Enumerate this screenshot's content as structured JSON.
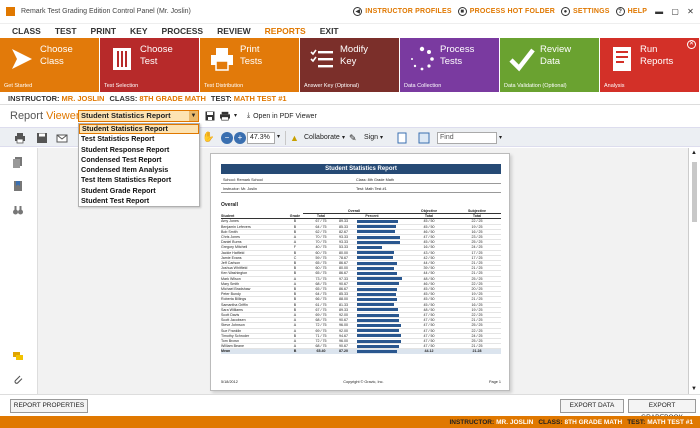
{
  "window": {
    "title": "Remark Test Grading Edition Control Panel (Mr. Joslin)"
  },
  "top_links": {
    "instructor_profiles": "INSTRUCTOR PROFILES",
    "process_hot_folder": "PROCESS HOT FOLDER",
    "settings": "SETTINGS",
    "help": "HELP"
  },
  "menu": [
    "CLASS",
    "TEST",
    "PRINT",
    "KEY",
    "PROCESS",
    "REVIEW",
    "REPORTS",
    "EXIT"
  ],
  "active_menu": "REPORTS",
  "ribbon": {
    "tiles": [
      {
        "label": "Choose\nClass",
        "sub": "Get Started",
        "color": "#e27a0a",
        "icon": "arrow-icon"
      },
      {
        "label": "Choose\nTest",
        "sub": "Test Selection",
        "color": "#b72a2a",
        "icon": "book-icon"
      },
      {
        "label": "Print\nTests",
        "sub": "Test Distribution",
        "color": "#e27a0a",
        "icon": "printer-icon"
      },
      {
        "label": "Modify\nKey",
        "sub": "Answer Key (Optional)",
        "color": "#7b2f2a",
        "icon": "list-icon"
      },
      {
        "label": "Process\nTests",
        "sub": "Data Collection",
        "color": "#7a3aa0",
        "icon": "spinner-icon"
      },
      {
        "label": "Review\nData",
        "sub": "Data Validation (Optional)",
        "color": "#6aa230",
        "icon": "check-icon"
      },
      {
        "label": "Run\nReports",
        "sub": "Analysis",
        "color": "#d33028",
        "icon": "report-icon"
      }
    ]
  },
  "breadcrumb": {
    "instructor_key": "INSTRUCTOR:",
    "instructor": "MR. JOSLIN",
    "class_key": "CLASS:",
    "class": "8TH GRADE MATH",
    "test_key": "TEST:",
    "test": "MATH TEST #1"
  },
  "viewer": {
    "title_a": "Report ",
    "title_b": "Viewer",
    "selected_report": "Student Statistics Report",
    "open_pdf": "Open in PDF Viewer"
  },
  "report_options": [
    "Student Statistics Report",
    "Test Statistics Report",
    "Student Response Report",
    "Condensed Test Report",
    "Condensed Item Analysis",
    "Test Item Statistics Report",
    "Student Grade Report",
    "Student Test Report"
  ],
  "toolbar": {
    "zoom": "47.3%",
    "collaborate": "Collaborate",
    "sign": "Sign",
    "find_placeholder": "Find"
  },
  "report": {
    "title": "Student Statistics Report",
    "school_label": "School:",
    "school": "Remark School",
    "class_label": "Class:",
    "class": "8th Grade Math",
    "instructor_label": "Instructor:",
    "instructor": "Mr. Joslin",
    "test_label": "Test:",
    "test": "Math Test #1",
    "section": "Overall",
    "group_headers": {
      "overall": "Overall",
      "objective": "Objective",
      "subjective": "Subjective"
    },
    "columns": {
      "student": "Student",
      "grade": "Grade",
      "total": "Total",
      "percent": "Percent",
      "obj_total": "Total",
      "subj_total": "Total"
    },
    "rows": [
      {
        "student": "Amy Jones",
        "grade": "B",
        "total": "67 / 75",
        "percent": 89.33,
        "obj": "45 / 50",
        "subj": "22 / 25"
      },
      {
        "student": "Benjamin Lefevers",
        "grade": "B",
        "total": "64 / 75",
        "percent": 85.33,
        "obj": "45 / 50",
        "subj": "19 / 25"
      },
      {
        "student": "Bob Smith",
        "grade": "B",
        "total": "62 / 75",
        "percent": 82.67,
        "obj": "46 / 50",
        "subj": "16 / 25"
      },
      {
        "student": "Chris Jones",
        "grade": "A",
        "total": "70 / 75",
        "percent": 93.33,
        "obj": "47 / 50",
        "subj": "23 / 25"
      },
      {
        "student": "Daniel Burns",
        "grade": "A",
        "total": "70 / 75",
        "percent": 93.33,
        "obj": "45 / 50",
        "subj": "25 / 25"
      },
      {
        "student": "Gregory Mitchell",
        "grade": "F",
        "total": "40 / 75",
        "percent": 53.33,
        "obj": "16 / 50",
        "subj": "24 / 25"
      },
      {
        "student": "Jackie Hatfield",
        "grade": "B",
        "total": "60 / 75",
        "percent": 80.0,
        "obj": "43 / 50",
        "subj": "17 / 25"
      },
      {
        "student": "Jamie Evans",
        "grade": "C",
        "total": "59 / 75",
        "percent": 78.67,
        "obj": "42 / 50",
        "subj": "17 / 25"
      },
      {
        "student": "Jeff Carlson",
        "grade": "B",
        "total": "65 / 75",
        "percent": 86.67,
        "obj": "44 / 50",
        "subj": "21 / 25"
      },
      {
        "student": "Joshua Whitfield",
        "grade": "B",
        "total": "60 / 75",
        "percent": 80.0,
        "obj": "39 / 50",
        "subj": "21 / 25"
      },
      {
        "student": "Ken Washington",
        "grade": "B",
        "total": "65 / 75",
        "percent": 86.67,
        "obj": "44 / 50",
        "subj": "21 / 25"
      },
      {
        "student": "Mark Wilson",
        "grade": "A",
        "total": "73 / 75",
        "percent": 97.33,
        "obj": "48 / 50",
        "subj": "25 / 25"
      },
      {
        "student": "Mary Smith",
        "grade": "A",
        "total": "68 / 75",
        "percent": 90.67,
        "obj": "46 / 50",
        "subj": "22 / 25"
      },
      {
        "student": "Michael Bradshaw",
        "grade": "B",
        "total": "65 / 75",
        "percent": 86.67,
        "obj": "45 / 50",
        "subj": "20 / 25"
      },
      {
        "student": "Peter Bundy",
        "grade": "B",
        "total": "64 / 75",
        "percent": 85.33,
        "obj": "45 / 50",
        "subj": "19 / 25"
      },
      {
        "student": "Roberta Billings",
        "grade": "B",
        "total": "66 / 75",
        "percent": 88.0,
        "obj": "45 / 50",
        "subj": "21 / 25"
      },
      {
        "student": "Samantha Griffin",
        "grade": "B",
        "total": "61 / 75",
        "percent": 81.33,
        "obj": "45 / 50",
        "subj": "16 / 25"
      },
      {
        "student": "Sara Williams",
        "grade": "B",
        "total": "67 / 75",
        "percent": 89.33,
        "obj": "48 / 50",
        "subj": "19 / 25"
      },
      {
        "student": "Scott Davis",
        "grade": "A",
        "total": "69 / 75",
        "percent": 92.0,
        "obj": "47 / 50",
        "subj": "22 / 25"
      },
      {
        "student": "Scott Jacobsen",
        "grade": "A",
        "total": "68 / 75",
        "percent": 90.67,
        "obj": "47 / 50",
        "subj": "21 / 25"
      },
      {
        "student": "Steve Johnson",
        "grade": "A",
        "total": "72 / 75",
        "percent": 96.0,
        "obj": "47 / 50",
        "subj": "25 / 25"
      },
      {
        "student": "Sue Franklin",
        "grade": "A",
        "total": "69 / 75",
        "percent": 92.0,
        "obj": "47 / 50",
        "subj": "22 / 25"
      },
      {
        "student": "Timothy Schroder",
        "grade": "B",
        "total": "71 / 75",
        "percent": 94.67,
        "obj": "47 / 50",
        "subj": "24 / 25"
      },
      {
        "student": "Tom Brown",
        "grade": "A",
        "total": "72 / 75",
        "percent": 96.0,
        "obj": "47 / 50",
        "subj": "25 / 25"
      },
      {
        "student": "William Beane",
        "grade": "A",
        "total": "68 / 75",
        "percent": 90.67,
        "obj": "47 / 50",
        "subj": "21 / 25"
      }
    ],
    "mean": {
      "student": "Mean",
      "grade": "B",
      "total": "65.40",
      "percent": 87.2,
      "obj": "44.12",
      "subj": "21.28"
    },
    "footer_date": "5/18/2012",
    "footer_copyright": "Copyright © Gravic, Inc.",
    "footer_page": "Page 1"
  },
  "bottom": {
    "report_properties": "REPORT PROPERTIES",
    "export_data": "EXPORT DATA",
    "export_gradebook": "EXPORT GRADEBOOK"
  },
  "status": {
    "instructor_key": "INSTRUCTOR:",
    "instructor": "MR. JOSLIN",
    "class_key": "CLASS:",
    "class": "8TH GRADE MATH",
    "test_key": "TEST:",
    "test": "MATH TEST #1"
  },
  "colors": {
    "accent": "#e07800",
    "report_header": "#264a75",
    "bar": "#2a578f"
  }
}
